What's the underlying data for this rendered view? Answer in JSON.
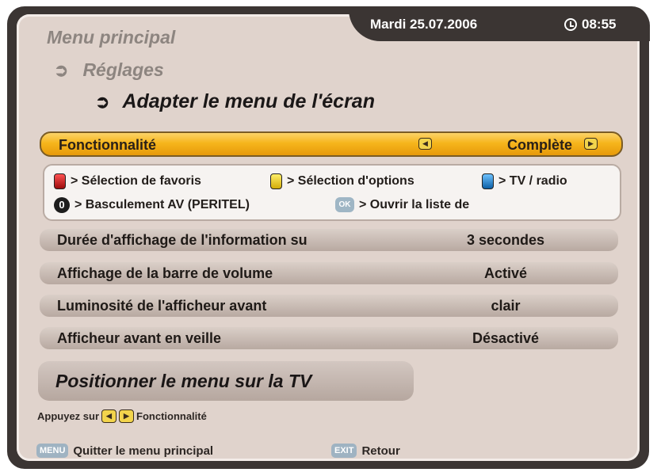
{
  "header": {
    "date": "Mardi 25.07.2006",
    "time": "08:55"
  },
  "breadcrumb": {
    "level1": "Menu principal",
    "level2": "Réglages",
    "level3": "Adapter le menu de l'écran"
  },
  "highlight_row": {
    "label": "Fonctionnalité",
    "value": "Complète"
  },
  "legend": {
    "red": "> Sélection de favoris",
    "yellow": "> Sélection d'options",
    "blue": "> TV / radio",
    "zero_key": "0",
    "zero": "> Basculement AV (PERITEL)",
    "ok_key": "OK",
    "ok": "> Ouvrir la liste de"
  },
  "rows": [
    {
      "label": "Durée d'affichage de l'information su",
      "value": "3 secondes"
    },
    {
      "label": "Affichage de la barre de volume",
      "value": "Activé"
    },
    {
      "label": "Luminosité de l'afficheur avant",
      "value": "clair"
    },
    {
      "label": "Afficheur avant en veille",
      "value": "Désactivé"
    }
  ],
  "position_button": "Positionner le menu sur la TV",
  "hint": {
    "prefix": "Appuyez sur",
    "suffix": "Fonctionnalité"
  },
  "footer": {
    "menu_key": "MENU",
    "menu_label": "Quitter le menu principal",
    "exit_key": "EXIT",
    "exit_label": "Retour"
  },
  "colors": {
    "highlight": "#f6b51c",
    "panel": "#e0d3cc",
    "frame": "#3b3533",
    "key_red": "#c41a1a",
    "key_yellow": "#f2d44c",
    "key_blue": "#1e7fd0"
  },
  "icons": [
    "clock-icon",
    "arrow-icon",
    "left-arrow-key-icon",
    "right-arrow-key-icon",
    "red-key-icon",
    "yellow-key-icon",
    "blue-key-icon",
    "zero-key-icon",
    "ok-key-icon",
    "menu-key-icon",
    "exit-key-icon"
  ]
}
